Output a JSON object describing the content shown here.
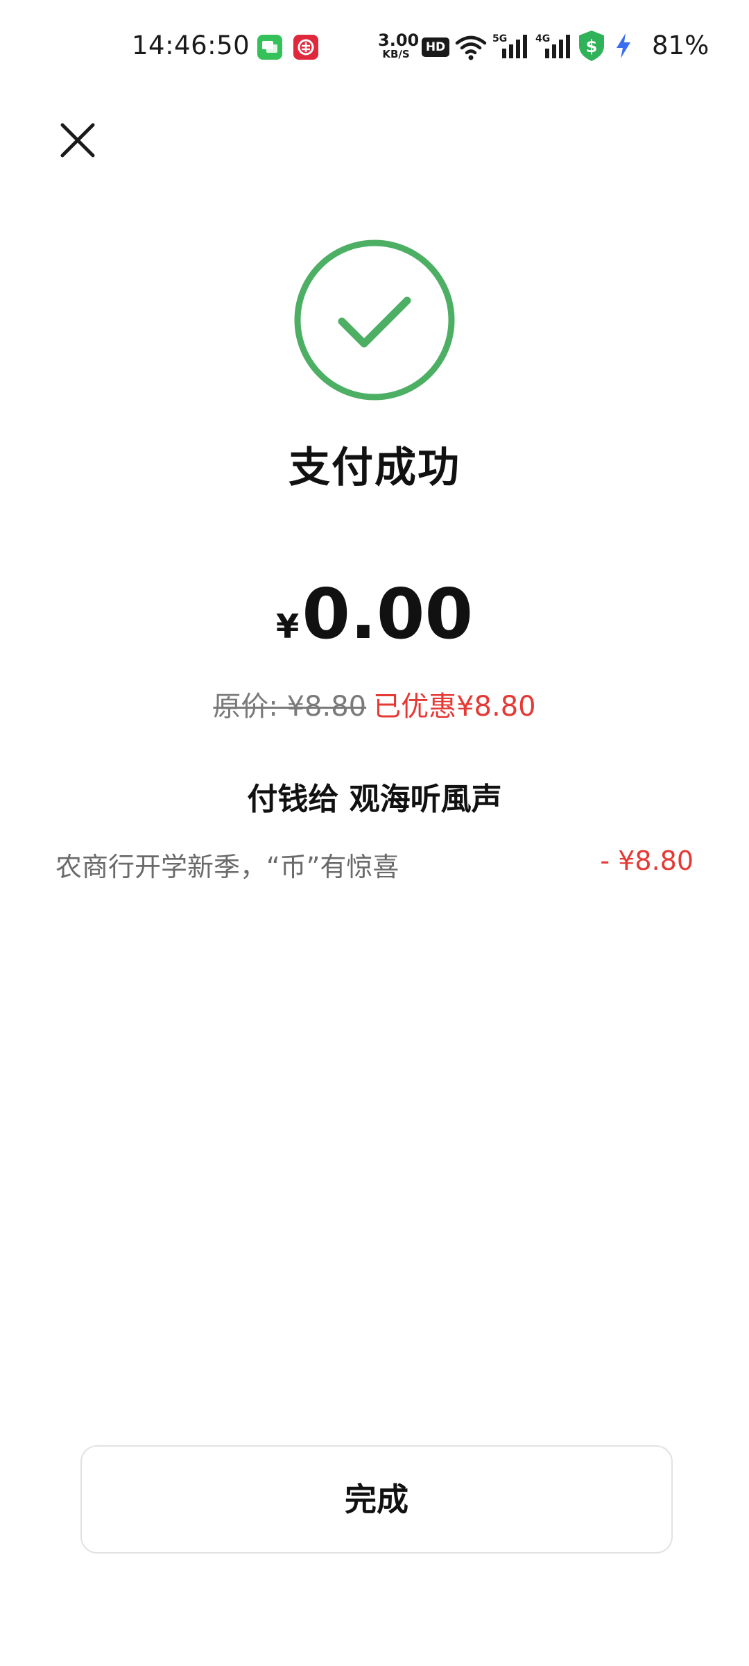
{
  "status_bar": {
    "time": "14:46:50",
    "net_speed_value": "3.00",
    "net_speed_unit": "KB/S",
    "hd_label": "HD",
    "signal_5g_label": "5G",
    "signal_4g_label": "4G",
    "battery": "81%",
    "icons": [
      "messages-app-icon",
      "bank-app-icon",
      "wifi-icon",
      "signal-5g-icon",
      "signal-4g-icon",
      "security-shield-icon",
      "charging-icon"
    ]
  },
  "header": {
    "close_icon": "close-icon"
  },
  "result": {
    "icon": "check-circle-icon",
    "accent_color": "#4caf63",
    "title": "支付成功",
    "currency_symbol": "¥",
    "amount": "0.00",
    "original_price": "原价: ¥8.80",
    "discount_total": "已优惠¥8.80",
    "payee": "付钱给 观海听風声",
    "discount_color": "#e53935"
  },
  "discounts": [
    {
      "name": "农商行开学新季，“币”有惊喜",
      "amount": "- ¥8.80"
    }
  ],
  "footer": {
    "done_label": "完成"
  }
}
